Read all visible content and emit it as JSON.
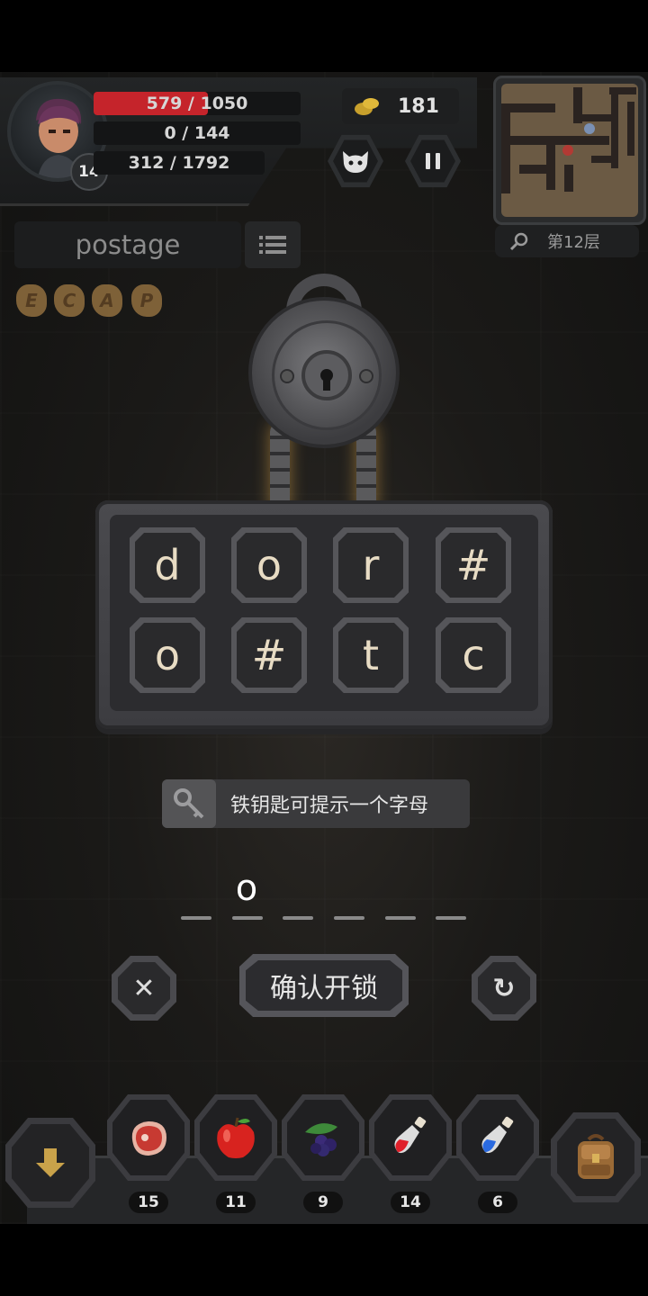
{
  "hud": {
    "level": "14",
    "hp": {
      "text": "579 / 1050",
      "fraction": 0.55,
      "color": "#c5242b"
    },
    "shield": {
      "text": "0 / 144"
    },
    "xp": {
      "text": "312 / 1792"
    },
    "gold": "181",
    "floor": "第12层"
  },
  "word_panel": {
    "word": "postage"
  },
  "runes": [
    "E",
    "C",
    "A",
    "P"
  ],
  "lock_board": {
    "tiles": [
      "d",
      "o",
      "r",
      "#",
      "o",
      "#",
      "t",
      "c"
    ]
  },
  "hint": {
    "text": "铁钥匙可提示一个字母"
  },
  "answer": {
    "letters": [
      "o",
      "",
      "",
      "",
      "",
      ""
    ]
  },
  "actions": {
    "cancel": "✕",
    "confirm": "确认开锁",
    "reset": "↻"
  },
  "inventory": [
    {
      "icon": "meat-icon",
      "count": "15"
    },
    {
      "icon": "apple-icon",
      "count": "11"
    },
    {
      "icon": "berries-icon",
      "count": "9"
    },
    {
      "icon": "red-potion-icon",
      "count": "14"
    },
    {
      "icon": "blue-potion-icon",
      "count": "6"
    }
  ]
}
